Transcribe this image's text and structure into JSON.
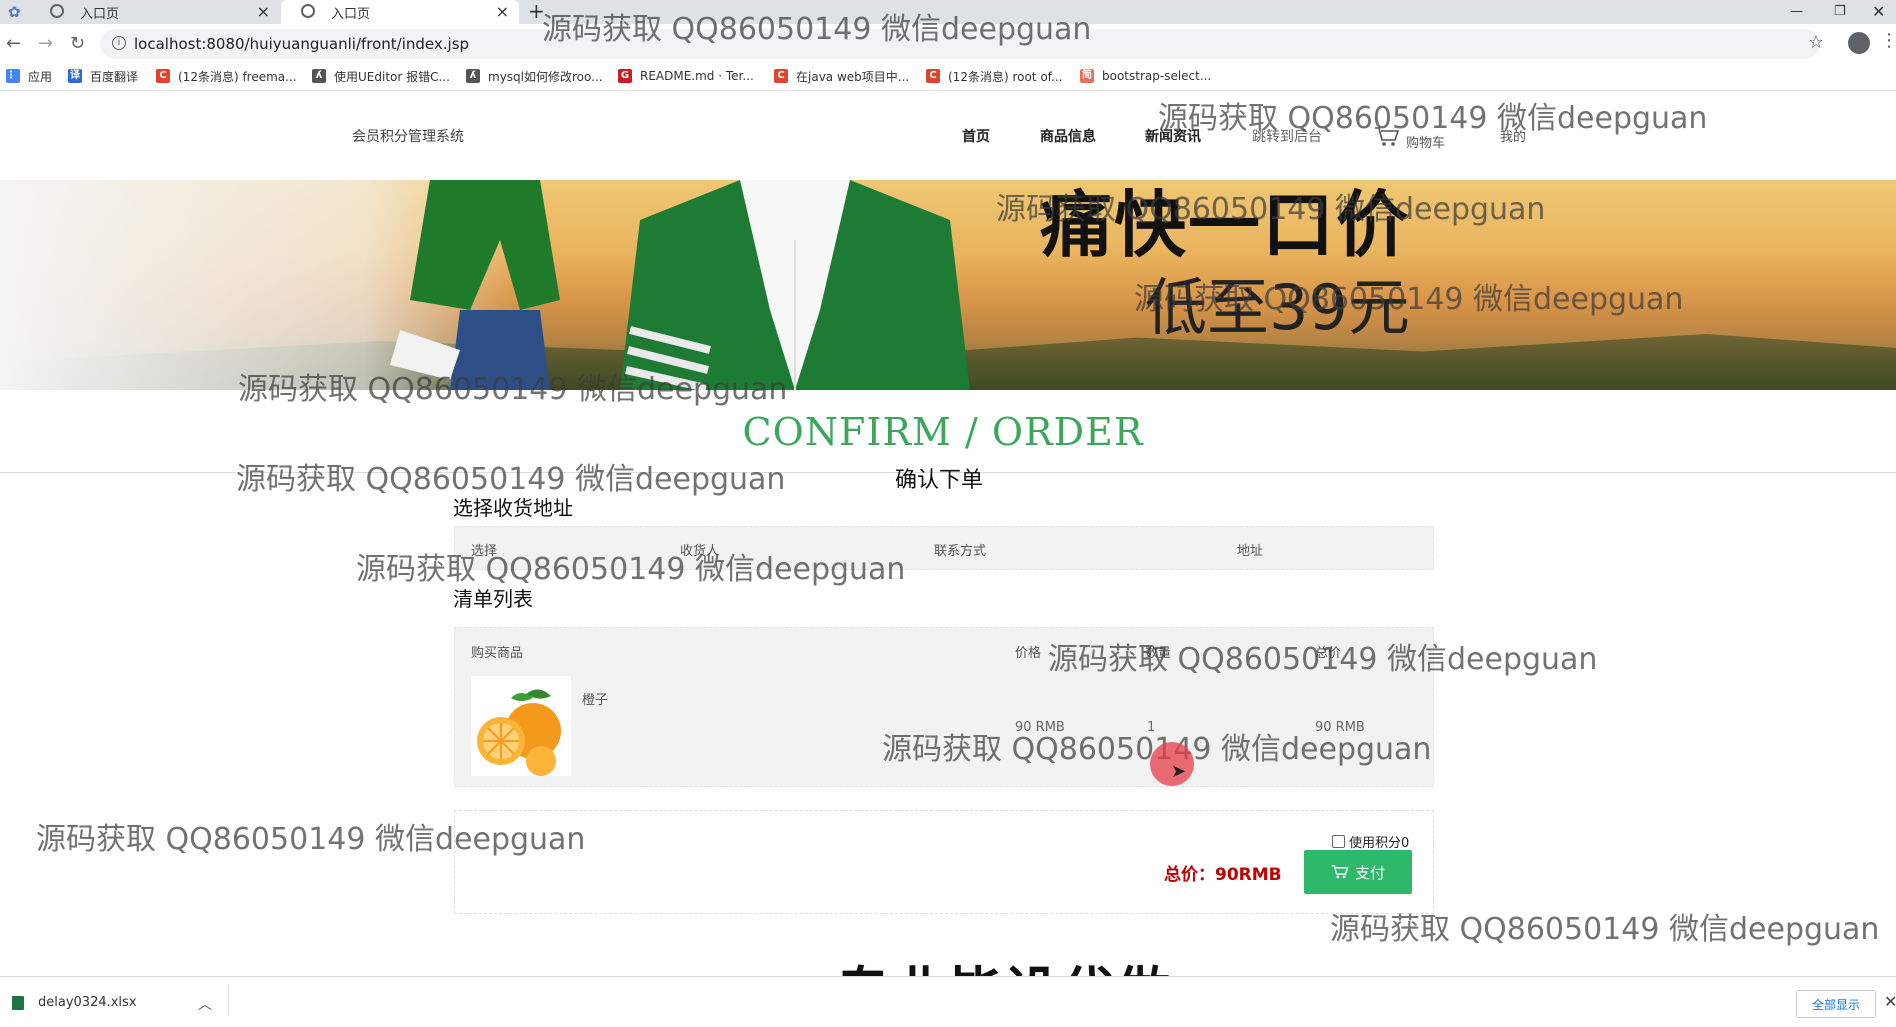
{
  "browser": {
    "tabs": [
      {
        "title": "入口页",
        "active": false
      },
      {
        "title": "入口页",
        "active": true
      }
    ],
    "new_tab": "+",
    "url": "localhost:8080/huiyuanguanli/front/index.jsp",
    "bookmarks": [
      {
        "label": "应用",
        "icon": "apps-grid-icon",
        "color": "#4285f4"
      },
      {
        "label": "百度翻译",
        "icon": "baidu-translate-icon",
        "color": "#2a6bd8"
      },
      {
        "label": "(12条消息) freema...",
        "icon": "csdn-icon",
        "color": "#e0442a"
      },
      {
        "label": "使用UEditor 报错C...",
        "icon": "ueditor-icon",
        "color": "#555555"
      },
      {
        "label": "mysql如何修改roo...",
        "icon": "mysql-icon",
        "color": "#555555"
      },
      {
        "label": "README.md · Ter...",
        "icon": "gitee-icon",
        "color": "#c71d23"
      },
      {
        "label": "在java web项目中...",
        "icon": "csdn-icon",
        "color": "#e0442a"
      },
      {
        "label": "(12条消息) root of...",
        "icon": "csdn-icon",
        "color": "#e0442a"
      },
      {
        "label": "bootstrap-select...",
        "icon": "jianshu-icon",
        "color": "#ea6f5a"
      }
    ]
  },
  "site": {
    "brand": "会员积分管理系统",
    "nav": [
      "首页",
      "商品信息",
      "新闻资讯",
      "跳转到后台",
      "购物车",
      "我的"
    ]
  },
  "banner": {
    "title": "痛快一口价",
    "subtitle": "低至39元"
  },
  "page": {
    "heading": "CONFIRM / ORDER",
    "subheading": "确认下单",
    "address_section": "选择收货地址",
    "address_headers": [
      "选择",
      "收货人",
      "联系方式",
      "地址"
    ],
    "list_section": "清单列表",
    "cart_headers": [
      "购买商品",
      "价格",
      "数量",
      "总价"
    ],
    "items": [
      {
        "name": "橙子",
        "price": "90 RMB",
        "qty": "1",
        "total": "90 RMB"
      }
    ],
    "use_points": "使用积分0",
    "total_label": "总价：90RMB",
    "pay_button": "支付"
  },
  "watermark": "源码获取 QQ86050149 微信deepguan",
  "overlay_caption": "专业毕设代做",
  "download": {
    "file": "delay0324.xlsx",
    "show_all": "全部显示"
  }
}
